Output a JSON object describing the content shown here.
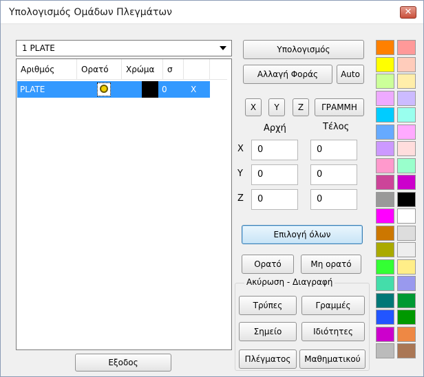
{
  "window": {
    "title": "Υπολογισμός Ομάδων Πλεγμάτων",
    "close_label": "✕"
  },
  "combo": {
    "selected": "1 PLATE"
  },
  "grid": {
    "headers": [
      "Αριθμός",
      "Ορατό",
      "Χρώμα",
      "σ"
    ],
    "row": {
      "name": "PLATE",
      "color_value": "0",
      "sigma": "X"
    }
  },
  "buttons": {
    "calculate": "Υπολογισμός",
    "change_direction": "Αλλαγή Φοράς",
    "auto": "Auto",
    "x": "X",
    "y": "Y",
    "z": "Z",
    "line": "ΓΡΑΜΜΗ",
    "select_all": "Επιλογή όλων",
    "visible": "Ορατό",
    "not_visible": "Μη ορατό",
    "holes": "Τρύπες",
    "lines": "Γραμμές",
    "point": "Σημείο",
    "properties": "Ιδιότητες",
    "mesh": "Πλέγματος",
    "mathematical": "Μαθηματικού",
    "exit": "Εξοδος"
  },
  "coords": {
    "start_label": "Αρχή",
    "end_label": "Τέλος",
    "axes": [
      "X",
      "Y",
      "Z"
    ],
    "start": [
      "0",
      "0",
      "0"
    ],
    "end": [
      "0",
      "0",
      "0"
    ]
  },
  "group": {
    "title": "Ακύρωση - Διαγραφή"
  },
  "palette": {
    "colors": [
      "#ff8000",
      "#ff9999",
      "#ffff00",
      "#ffccbb",
      "#ccff99",
      "#ffeeaa",
      "#eeaaff",
      "#ccbbff",
      "#00ccff",
      "#99ffee",
      "#66aaff",
      "#ffaaff",
      "#cc99ff",
      "#ffdddd",
      "#ff99cc",
      "#99ffcc",
      "#cc4499",
      "#cc00cc",
      "#999999",
      "#000000",
      "#ff00ff",
      "#ffffff",
      "#cc7700",
      "#dddddd",
      "#aaaa00",
      "#eeeeee",
      "#33ff33",
      "#ffee88",
      "#44ddaa",
      "#9999ee",
      "#007777",
      "#009933",
      "#2255ff",
      "#009900",
      "#cc00cc",
      "#ee8844",
      "#bbbbbb",
      "#aa7755"
    ]
  }
}
